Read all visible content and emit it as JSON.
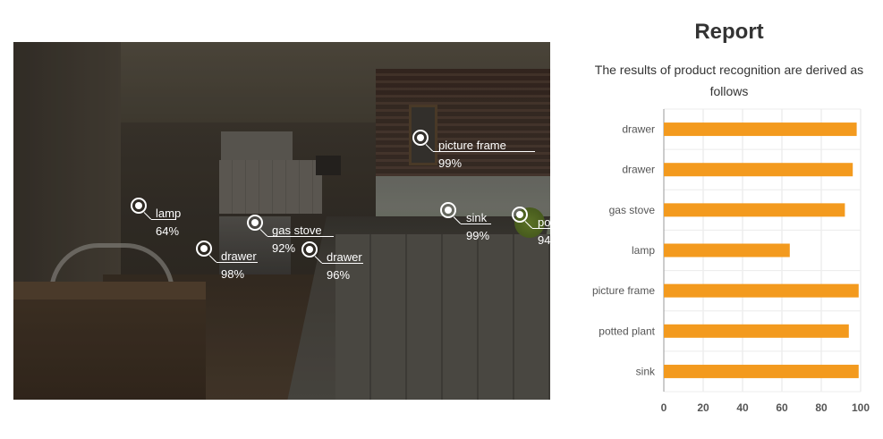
{
  "detections": [
    {
      "label": "lamp",
      "confidence": "64%"
    },
    {
      "label": "drawer",
      "confidence": "98%"
    },
    {
      "label": "gas stove",
      "confidence": "92%"
    },
    {
      "label": "drawer",
      "confidence": "96%"
    },
    {
      "label": "picture frame",
      "confidence": "99%"
    },
    {
      "label": "sink",
      "confidence": "99%"
    },
    {
      "label": "po",
      "confidence": "94"
    }
  ],
  "report": {
    "title": "Report",
    "subtitle": "The results of product recognition are derived as follows"
  },
  "chart_data": {
    "type": "bar",
    "orientation": "horizontal",
    "categories": [
      "drawer",
      "drawer",
      "gas stove",
      "lamp",
      "picture frame",
      "potted plant",
      "sink"
    ],
    "values": [
      98,
      96,
      92,
      64,
      99,
      94,
      99
    ],
    "xlim": [
      0,
      100
    ],
    "xticks": [
      0,
      20,
      40,
      60,
      80,
      100
    ],
    "grid": true,
    "bar_color": "#f39a1e",
    "title": "",
    "xlabel": "",
    "ylabel": ""
  }
}
